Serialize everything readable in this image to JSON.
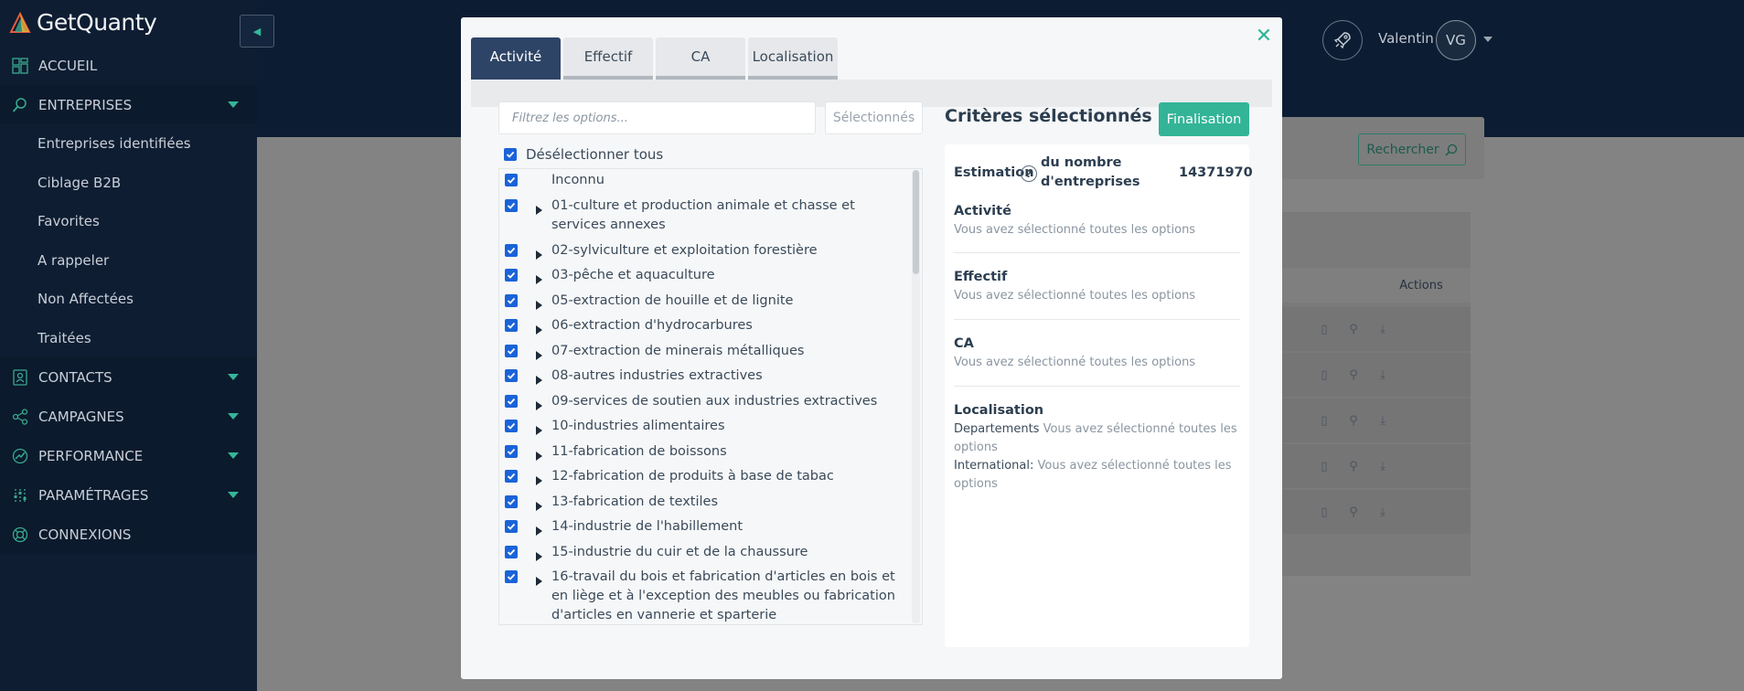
{
  "app": {
    "brand": "GetQuanty",
    "user_name": "Valentin",
    "user_initials": "VG"
  },
  "sidebar": {
    "items": [
      {
        "label": "ACCUEIL",
        "icon": "dashboard-icon",
        "caret": false
      },
      {
        "label": "ENTREPRISES",
        "icon": "search-icon",
        "caret": true
      },
      {
        "label": "CONTACTS",
        "icon": "contact-card-icon",
        "caret": true
      },
      {
        "label": "CAMPAGNES",
        "icon": "share-nodes-icon",
        "caret": true
      },
      {
        "label": "PERFORMANCE",
        "icon": "chart-line-icon",
        "caret": true
      },
      {
        "label": "PARAMÉTRAGES",
        "icon": "sliders-icon",
        "caret": true
      },
      {
        "label": "CONNEXIONS",
        "icon": "lifebuoy-icon",
        "caret": false
      }
    ],
    "sub_items": [
      "Entreprises identifiées",
      "Ciblage B2B",
      "Favorites",
      "A rappeler",
      "Non Affectées",
      "Traitées"
    ]
  },
  "background": {
    "search_button": "Rechercher",
    "actions_header": "Actions"
  },
  "modal": {
    "tabs": [
      {
        "label": "Activité",
        "active": true
      },
      {
        "label": "Effectif",
        "active": false
      },
      {
        "label": "CA",
        "active": false
      },
      {
        "label": "Localisation",
        "active": false
      }
    ],
    "filter_placeholder": "Filtrez les options...",
    "selected_button": "Sélectionnés",
    "deselect_all": "Désélectionner tous",
    "options": [
      {
        "label": "Inconnu",
        "expandable": false,
        "checked": true
      },
      {
        "label": "01-culture et production animale et chasse et services annexes",
        "expandable": true,
        "checked": true
      },
      {
        "label": "02-sylviculture et exploitation forestière",
        "expandable": true,
        "checked": true
      },
      {
        "label": "03-pêche et aquaculture",
        "expandable": true,
        "checked": true
      },
      {
        "label": "05-extraction de houille et de lignite",
        "expandable": true,
        "checked": true
      },
      {
        "label": "06-extraction d'hydrocarbures",
        "expandable": true,
        "checked": true
      },
      {
        "label": "07-extraction de minerais métalliques",
        "expandable": true,
        "checked": true
      },
      {
        "label": "08-autres industries extractives",
        "expandable": true,
        "checked": true
      },
      {
        "label": "09-services de soutien aux industries extractives",
        "expandable": true,
        "checked": true
      },
      {
        "label": "10-industries alimentaires",
        "expandable": true,
        "checked": true
      },
      {
        "label": "11-fabrication de boissons",
        "expandable": true,
        "checked": true
      },
      {
        "label": "12-fabrication de produits à base de tabac",
        "expandable": true,
        "checked": true
      },
      {
        "label": "13-fabrication de textiles",
        "expandable": true,
        "checked": true
      },
      {
        "label": "14-industrie de l'habillement",
        "expandable": true,
        "checked": true
      },
      {
        "label": "15-industrie du cuir et de la chaussure",
        "expandable": true,
        "checked": true
      },
      {
        "label": "16-travail du bois et fabrication d'articles en bois et en liège et à l'exception des meubles ou fabrication d'articles en vannerie et sparterie",
        "expandable": true,
        "checked": true
      }
    ],
    "criteria": {
      "title": "Critères sélectionnés",
      "finalize_button": "Finalisation",
      "estimation_label": "Estimation",
      "estimation_sub": "du nombre d'entreprises",
      "estimation_value": "14371970",
      "help_glyph": "?",
      "blocks": [
        {
          "title": "Activité",
          "value": "Vous avez sélectionné toutes les options"
        },
        {
          "title": "Effectif",
          "value": "Vous avez sélectionné toutes les options"
        },
        {
          "title": "CA",
          "value": "Vous avez sélectionné toutes les options"
        }
      ],
      "localisation": {
        "title": "Localisation",
        "departements_label": "Departements",
        "departements_value": "Vous avez sélectionné toutes les options",
        "international_label": "International:",
        "international_value": "Vous avez sélectionné toutes les options"
      }
    }
  },
  "colors": {
    "accent": "#33b497",
    "tab_active": "#2e4466",
    "checkbox": "#1a63d8",
    "sidebar_bg": "#0e1d32"
  }
}
